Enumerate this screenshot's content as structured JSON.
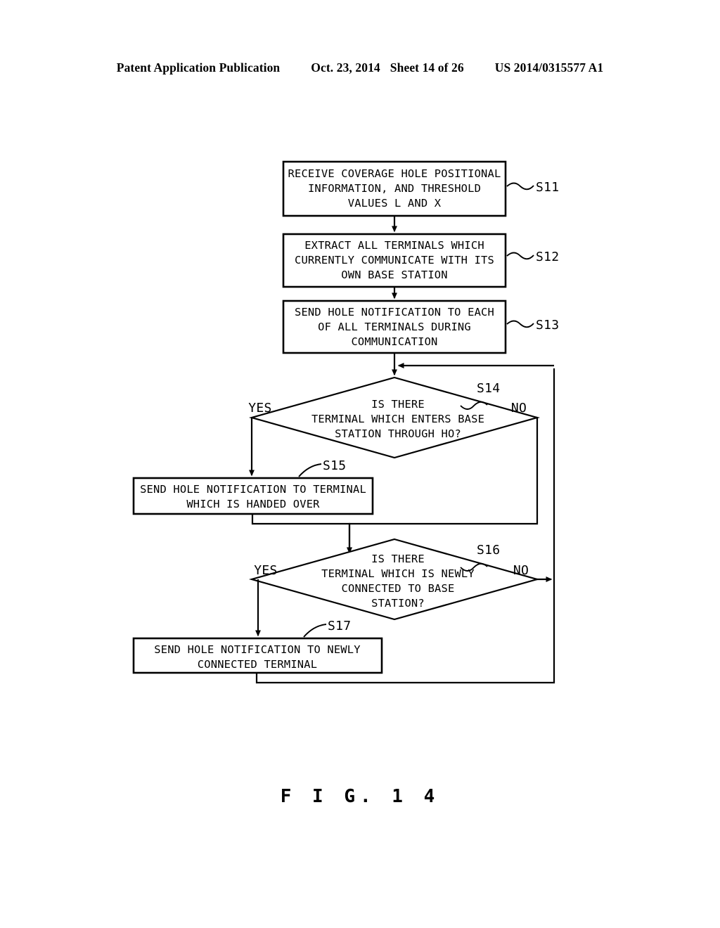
{
  "header": {
    "publication": "Patent Application Publication",
    "date": "Oct. 23, 2014",
    "sheet": "Sheet 14 of 26",
    "number": "US 2014/0315577 A1"
  },
  "figure": {
    "caption": "F I G.  1 4"
  },
  "flowchart": {
    "type": "flowchart",
    "nodes": [
      {
        "id": "S11",
        "shape": "process",
        "label": "S11",
        "lines": [
          "RECEIVE COVERAGE HOLE POSITIONAL",
          "INFORMATION, AND THRESHOLD",
          "VALUES L AND X"
        ]
      },
      {
        "id": "S12",
        "shape": "process",
        "label": "S12",
        "lines": [
          "EXTRACT ALL TERMINALS WHICH",
          "CURRENTLY COMMUNICATE WITH ITS",
          "OWN BASE STATION"
        ]
      },
      {
        "id": "S13",
        "shape": "process",
        "label": "S13",
        "lines": [
          "SEND HOLE NOTIFICATION TO EACH",
          "OF ALL TERMINALS DURING",
          "COMMUNICATION"
        ]
      },
      {
        "id": "S14",
        "shape": "decision",
        "label": "S14",
        "lines": [
          "IS THERE",
          "TERMINAL WHICH ENTERS BASE",
          "STATION THROUGH HO?"
        ],
        "yes": "YES",
        "no": "NO"
      },
      {
        "id": "S15",
        "shape": "process",
        "label": "S15",
        "lines": [
          "SEND HOLE NOTIFICATION TO TERMINAL",
          "WHICH IS HANDED OVER"
        ]
      },
      {
        "id": "S16",
        "shape": "decision",
        "label": "S16",
        "lines": [
          "IS THERE",
          "TERMINAL WHICH IS NEWLY",
          "CONNECTED TO BASE",
          "STATION?"
        ],
        "yes": "YES",
        "no": "NO"
      },
      {
        "id": "S17",
        "shape": "process",
        "label": "S17",
        "lines": [
          "SEND HOLE NOTIFICATION TO NEWLY",
          "CONNECTED TERMINAL"
        ]
      }
    ],
    "edges": [
      {
        "from": "S11",
        "to": "S12",
        "label": ""
      },
      {
        "from": "S12",
        "to": "S13",
        "label": ""
      },
      {
        "from": "S13",
        "to": "S14",
        "label": ""
      },
      {
        "from": "S14",
        "to": "S15",
        "label": "YES"
      },
      {
        "from": "S14",
        "to": "S16",
        "label": "NO"
      },
      {
        "from": "S15",
        "to": "S16",
        "label": ""
      },
      {
        "from": "S16",
        "to": "S17",
        "label": "YES"
      },
      {
        "from": "S16",
        "to": "S14",
        "label": "NO"
      },
      {
        "from": "S17",
        "to": "S14",
        "label": ""
      }
    ]
  }
}
